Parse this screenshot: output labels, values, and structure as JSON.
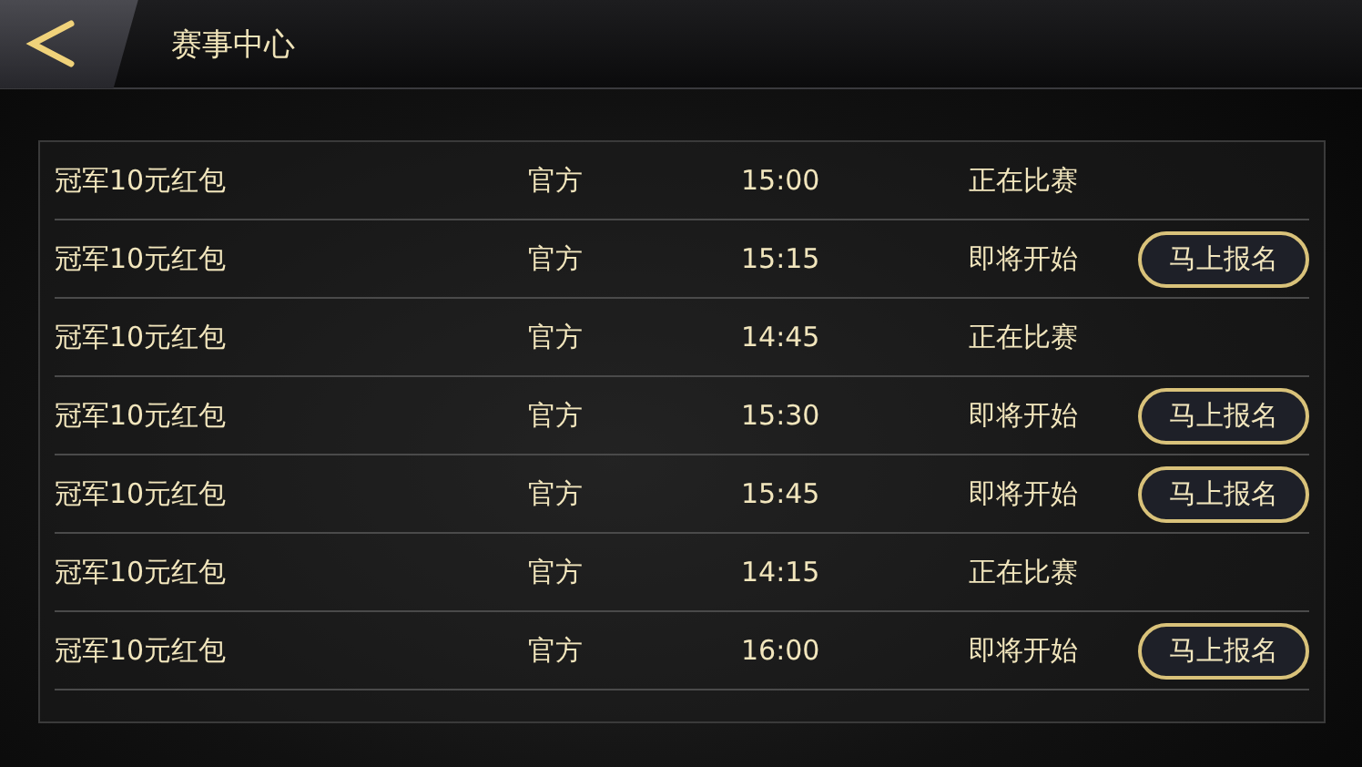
{
  "header": {
    "title": "赛事中心"
  },
  "rows": [
    {
      "name": "冠军10元红包",
      "organizer": "官方",
      "time": "15:00",
      "status": "正在比赛"
    },
    {
      "name": "冠军10元红包",
      "organizer": "官方",
      "time": "15:15",
      "status": "即将开始",
      "button": "马上报名"
    },
    {
      "name": "冠军10元红包",
      "organizer": "官方",
      "time": "14:45",
      "status": "正在比赛"
    },
    {
      "name": "冠军10元红包",
      "organizer": "官方",
      "time": "15:30",
      "status": "即将开始",
      "button": "马上报名"
    },
    {
      "name": "冠军10元红包",
      "organizer": "官方",
      "time": "15:45",
      "status": "即将开始",
      "button": "马上报名"
    },
    {
      "name": "冠军10元红包",
      "organizer": "官方",
      "time": "14:15",
      "status": "正在比赛"
    },
    {
      "name": "冠军10元红包",
      "organizer": "官方",
      "time": "16:00",
      "status": "即将开始",
      "button": "马上报名"
    }
  ]
}
